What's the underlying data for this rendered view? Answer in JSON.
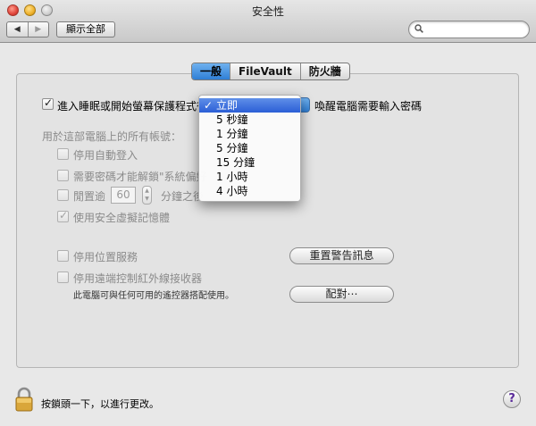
{
  "window": {
    "title": "安全性"
  },
  "toolbar": {
    "back_label": "◀",
    "forward_label": "▶",
    "show_all_label": "顯示全部",
    "search_placeholder": "",
    "search_value": ""
  },
  "tabs": [
    {
      "label": "一般",
      "active": true
    },
    {
      "label": "FileVault",
      "active": false
    },
    {
      "label": "防火牆",
      "active": false
    }
  ],
  "general": {
    "sleep_prefix": "進入睡眠或開始螢幕保護程式後",
    "sleep_suffix": "喚醒電腦需要輸入密碼",
    "all_accounts_label": "用於這部電腦上的所有帳號：",
    "disable_autologin": "停用自動登入",
    "require_password_prefix": "需要密碼才能解鎖\"系統偏好",
    "require_password_tail": "",
    "logout_prefix": "閒置逾",
    "logout_minutes": "60",
    "logout_suffix": "分鐘之後",
    "secure_vm": "使用安全虛擬記憶體",
    "disable_location": "停用位置服務",
    "reset_warnings": "重置警告訊息",
    "disable_ir": "停用遠端控制紅外線接收器",
    "ir_note": "此電腦可與任何可用的遙控器搭配使用。",
    "pair_button": "配對⋯"
  },
  "delay_menu": {
    "selected_mark": "✓",
    "options": [
      "立即",
      "5 秒鐘",
      "1 分鐘",
      "5 分鐘",
      "15 分鐘",
      "1 小時",
      "4 小時"
    ]
  },
  "footer": {
    "lock_text": "按鎖頭一下，以進行更改。",
    "help": "?"
  },
  "colors": {
    "accent": "#2f7fd6",
    "menu_highlight": "#2b5ed6",
    "help_glyph": "#5a2a9a"
  }
}
